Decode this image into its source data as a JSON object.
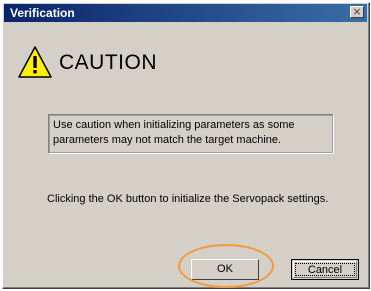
{
  "window": {
    "title": "Verification",
    "close_glyph": "×"
  },
  "caution": {
    "heading": "CAUTION",
    "icon": "warning-triangle-icon",
    "icon_color": "#ffef00"
  },
  "message": {
    "text": "Use caution when initializing parameters as some parameters may not match the target machine."
  },
  "info": {
    "text": "Clicking the OK button to initialize the Servopack settings."
  },
  "buttons": {
    "ok": "OK",
    "cancel": "Cancel"
  },
  "annotation": {
    "highlight_color": "#f29a3c"
  }
}
